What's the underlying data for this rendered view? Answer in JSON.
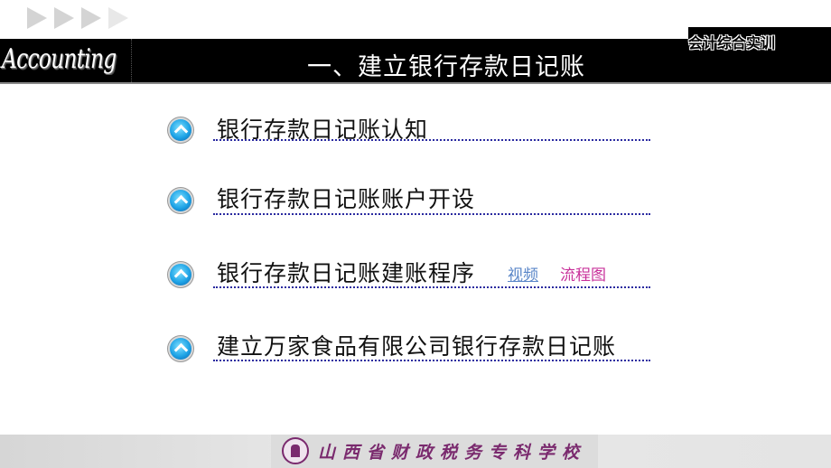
{
  "header": {
    "logo_text": "Accounting",
    "title": "一、建立银行存款日记账",
    "course_label": "会计综合实训"
  },
  "menu": {
    "items": [
      {
        "label": "银行存款日记账认知",
        "icon": "circle-arrow-up-icon"
      },
      {
        "label": "银行存款日记账账户开设",
        "icon": "circle-arrow-up-icon"
      },
      {
        "label": "银行存款日记账建账程序",
        "icon": "circle-arrow-up-icon",
        "links": [
          {
            "label": "视频",
            "color": "#5a86c8"
          },
          {
            "label": "流程图",
            "color": "#c8309a"
          }
        ]
      },
      {
        "label": "建立万家食品有限公司银行存款日记账",
        "icon": "circle-arrow-up-icon"
      }
    ]
  },
  "footer": {
    "school_name": "山西省财政税务专科学校",
    "seal_icon": "school-seal-icon",
    "brand_color": "#7a2a6e"
  },
  "decorations": {
    "arrows_icon": "play-arrows-icon"
  }
}
